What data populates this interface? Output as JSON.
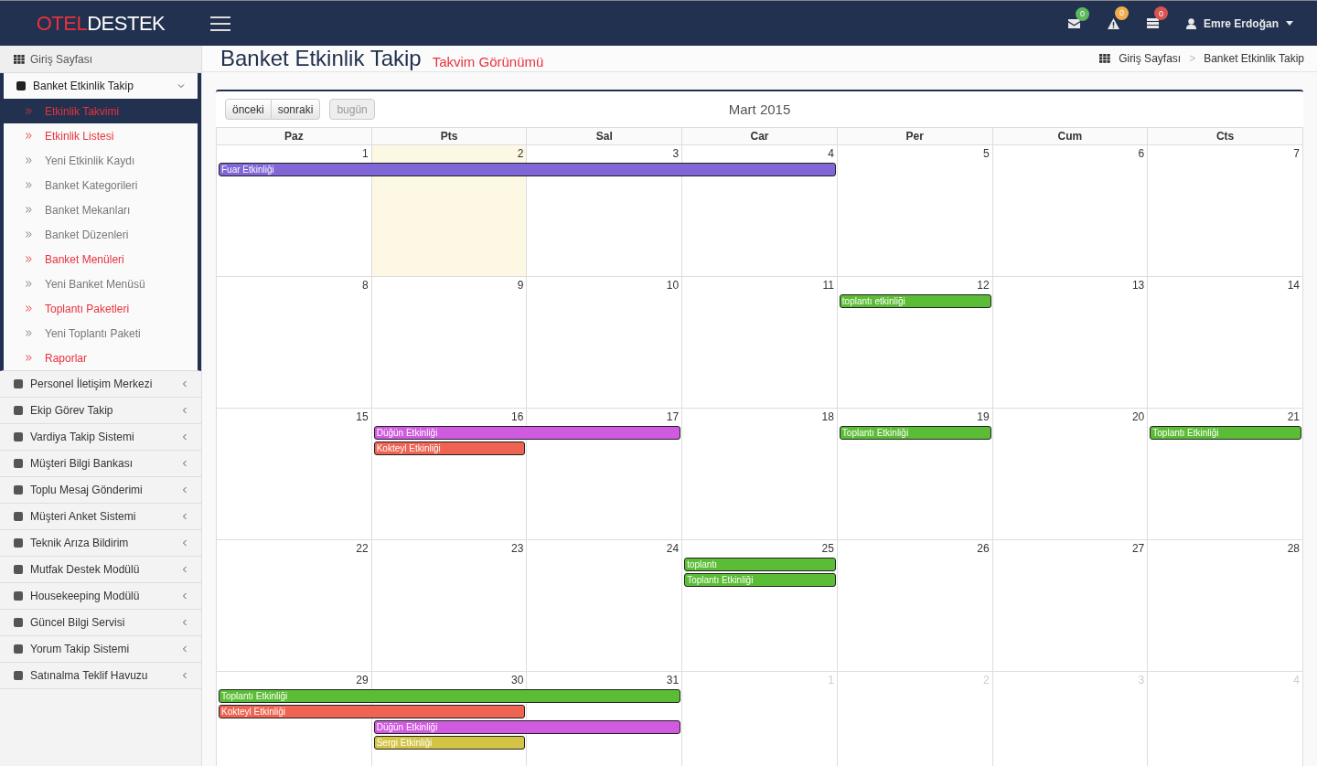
{
  "header": {
    "logo": {
      "first": "OTEL",
      "second": "DESTEK"
    },
    "notifications": [
      {
        "kind": "mail",
        "count": "0",
        "color": "#5cb85c"
      },
      {
        "kind": "warning",
        "count": "0",
        "color": "#f0ad4e"
      },
      {
        "kind": "list",
        "count": "0",
        "color": "#d9534f"
      }
    ],
    "user": "Emre Erdoğan"
  },
  "sidebar": {
    "home": "Giriş Sayfası",
    "groups": [
      {
        "label": "Banket Etkinlik Takip",
        "expanded": true,
        "children": [
          {
            "label": "Etkinlik Takvimi",
            "selected": true,
            "highlighted": true
          },
          {
            "label": "Etkinlik Listesi",
            "selected": false,
            "highlighted": true
          },
          {
            "label": "Yeni Etkinlik Kaydı",
            "selected": false,
            "highlighted": false
          },
          {
            "label": "Banket Kategorileri",
            "selected": false,
            "highlighted": false
          },
          {
            "label": "Banket Mekanları",
            "selected": false,
            "highlighted": false
          },
          {
            "label": "Banket Düzenleri",
            "selected": false,
            "highlighted": false
          },
          {
            "label": "Banket Menüleri",
            "selected": false,
            "highlighted": true
          },
          {
            "label": "Yeni Banket Menüsü",
            "selected": false,
            "highlighted": false
          },
          {
            "label": "Toplantı Paketleri",
            "selected": false,
            "highlighted": true
          },
          {
            "label": "Yeni Toplantı Paketi",
            "selected": false,
            "highlighted": false
          },
          {
            "label": "Raporlar",
            "selected": false,
            "highlighted": true
          }
        ]
      },
      {
        "label": "Personel İletişim Merkezi",
        "expanded": false
      },
      {
        "label": "Ekip Görev Takip",
        "expanded": false
      },
      {
        "label": "Vardiya Takip Sistemi",
        "expanded": false
      },
      {
        "label": "Müşteri Bilgi Bankası",
        "expanded": false
      },
      {
        "label": "Toplu Mesaj Gönderimi",
        "expanded": false
      },
      {
        "label": "Müşteri Anket Sistemi",
        "expanded": false
      },
      {
        "label": "Teknik Arıza Bildirim",
        "expanded": false
      },
      {
        "label": "Mutfak Destek Modülü",
        "expanded": false
      },
      {
        "label": "Housekeeping Modülü",
        "expanded": false
      },
      {
        "label": "Güncel Bilgi Servisi",
        "expanded": false
      },
      {
        "label": "Yorum Takip Sistemi",
        "expanded": false
      },
      {
        "label": "Satınalma Teklif Havuzu",
        "expanded": false
      }
    ]
  },
  "page": {
    "title": "Banket Etkinlik Takip",
    "subtitle": "Takvim Görünümü",
    "breadcrumb": [
      {
        "label": "Giriş Sayfası"
      },
      {
        "label": ">"
      },
      {
        "label": "Banket Etkinlik Takip"
      }
    ]
  },
  "calendar": {
    "buttons": [
      {
        "label": "önceki",
        "disabled": false
      },
      {
        "label": "sonraki",
        "disabled": false
      },
      {
        "label": "bugün",
        "disabled": true
      }
    ],
    "title": "Mart 2015",
    "weekdays": [
      "Paz",
      "Pts",
      "Sal",
      "Car",
      "Per",
      "Cum",
      "Cts"
    ],
    "weeks": [
      {
        "days": [
          {
            "label": "1",
            "today": false,
            "other_month": false,
            "events": [
              {
                "title": "Fuar Etkinliği",
                "color": "#8066d6",
                "through_next_days": [
                  true,
                  true,
                  true
                ]
              }
            ]
          },
          {
            "label": "2",
            "today": true,
            "other_month": false
          },
          {
            "label": "3",
            "today": false,
            "other_month": false
          },
          {
            "label": "4",
            "today": false,
            "other_month": false
          },
          {
            "label": "5",
            "today": false,
            "other_month": false
          },
          {
            "label": "6",
            "today": false,
            "other_month": false
          },
          {
            "label": "7",
            "today": false,
            "other_month": false
          }
        ]
      },
      {
        "days": [
          {
            "label": "8",
            "today": false,
            "other_month": false
          },
          {
            "label": "9",
            "today": false,
            "other_month": false
          },
          {
            "label": "10",
            "today": false,
            "other_month": false
          },
          {
            "label": "11",
            "today": false,
            "other_month": false
          },
          {
            "label": "12",
            "today": false,
            "other_month": false,
            "events": [
              {
                "title": "toplantı etkinliği",
                "color": "#5bbd35"
              }
            ]
          },
          {
            "label": "13",
            "today": false,
            "other_month": false
          },
          {
            "label": "14",
            "today": false,
            "other_month": false
          }
        ]
      },
      {
        "days": [
          {
            "label": "15",
            "today": false,
            "other_month": false
          },
          {
            "label": "16",
            "today": false,
            "other_month": false,
            "events": [
              {
                "title": "Düğün Etkinliği",
                "color": "#d05ae0",
                "through_next_days": [
                  true
                ]
              },
              {
                "title": "Kokteyl Etkinliği",
                "color": "#ee6352"
              }
            ]
          },
          {
            "label": "17",
            "today": false,
            "other_month": false
          },
          {
            "label": "18",
            "today": false,
            "other_month": false
          },
          {
            "label": "19",
            "today": false,
            "other_month": false,
            "events": [
              {
                "title": "Toplantı Etkinliği",
                "color": "#5bbd35"
              }
            ]
          },
          {
            "label": "20",
            "today": false,
            "other_month": false
          },
          {
            "label": "21",
            "today": false,
            "other_month": false,
            "events": [
              {
                "title": "Toplantı Etkinliği",
                "color": "#5bbd35"
              }
            ]
          }
        ]
      },
      {
        "days": [
          {
            "label": "22",
            "today": false,
            "other_month": false
          },
          {
            "label": "23",
            "today": false,
            "other_month": false
          },
          {
            "label": "24",
            "today": false,
            "other_month": false
          },
          {
            "label": "25",
            "today": false,
            "other_month": false,
            "events": [
              {
                "title": "toplantı",
                "color": "#5bbd35"
              },
              {
                "title": "Toplantı Etkinliği",
                "color": "#5bbd35"
              }
            ]
          },
          {
            "label": "26",
            "today": false,
            "other_month": false
          },
          {
            "label": "27",
            "today": false,
            "other_month": false
          },
          {
            "label": "28",
            "today": false,
            "other_month": false
          }
        ]
      },
      {
        "days": [
          {
            "label": "29",
            "today": false,
            "other_month": false,
            "events": [
              {
                "title": "Toplantı Etkinliği",
                "color": "#5bbd35",
                "through_next_days": [
                  true,
                  true
                ]
              },
              {
                "title": "Kokteyl Etkinliği",
                "color": "#ee6352",
                "through_next_days": [
                  true
                ]
              }
            ]
          },
          {
            "label": "30",
            "today": false,
            "other_month": false,
            "events": [
              {
                "title": "Düğün Etkinliği",
                "color": "#d05ae0",
                "through_next_days": [
                  true
                ]
              },
              {
                "title": "Sergi Etkinliği",
                "color": "#d3c445"
              }
            ]
          },
          {
            "label": "31",
            "today": false,
            "other_month": false
          },
          {
            "label": "1",
            "today": false,
            "other_month": true
          },
          {
            "label": "2",
            "today": false,
            "other_month": true
          },
          {
            "label": "3",
            "today": false,
            "other_month": true
          },
          {
            "label": "4",
            "today": false,
            "other_month": true
          }
        ]
      }
    ]
  }
}
